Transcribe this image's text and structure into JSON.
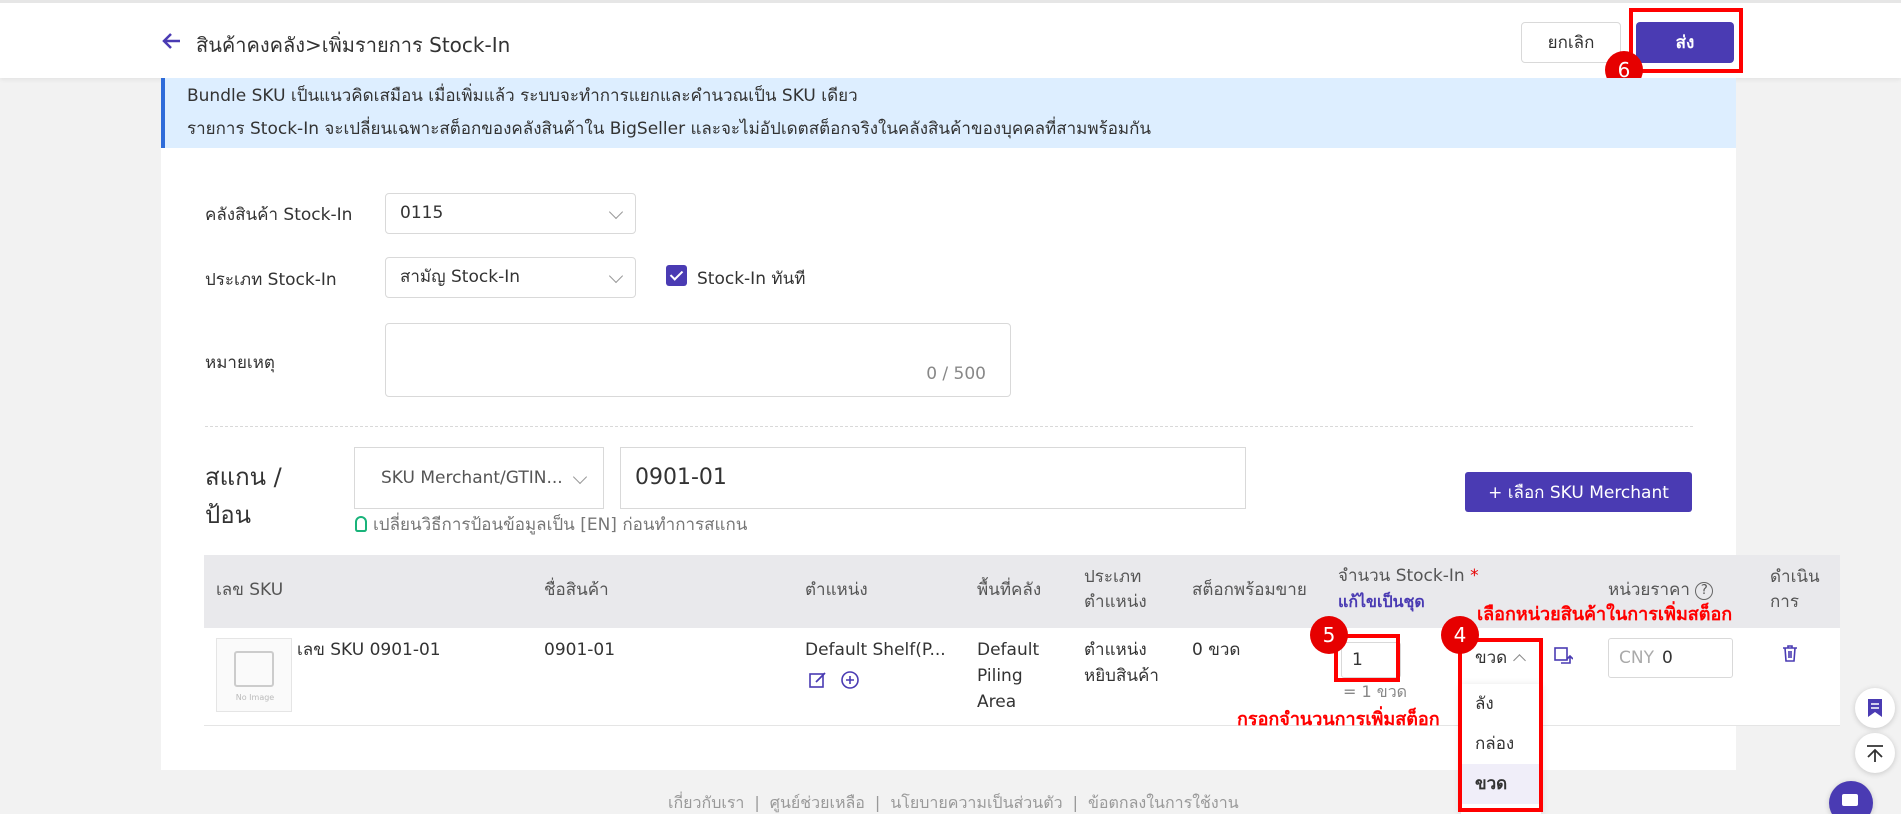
{
  "header": {
    "breadcrumb": "สินค้าคงคลัง>เพิ่มรายการ Stock-In",
    "cancel_label": "ยกเลิก",
    "submit_label": "ส่ง"
  },
  "notice": {
    "line1": "Bundle SKU เป็นแนวคิดเสมือน เมื่อเพิ่มแล้ว ระบบจะทำการแยกและคำนวณเป็น SKU เดียว",
    "line2": "รายการ Stock-In จะเปลี่ยนเฉพาะสต็อกของคลังสินค้าใน BigSeller และจะไม่อัปเดตสต็อกจริงในคลังสินค้าของบุคคลที่สามพร้อมกัน"
  },
  "form": {
    "warehouse_label": "คลังสินค้า Stock-In",
    "warehouse_value": "0115",
    "type_label": "ประเภท Stock-In",
    "type_value": "สามัญ Stock-In",
    "instant_label": "Stock-In ทันที",
    "instant_checked": true,
    "note_label": "หมายเหตุ",
    "note_counter": "0 / 500"
  },
  "scan": {
    "label_line1": "สแกน /",
    "label_line2": "ป้อน",
    "mode_value": "SKU Merchant/GTIN...",
    "input_value": "0901-01",
    "tip": "เปลี่ยนวิธีการป้อนข้อมูลเป็น [EN] ก่อนทำการสแกน",
    "add_button": "+ เลือก SKU Merchant"
  },
  "table": {
    "headers": {
      "sku": "เลข SKU",
      "name": "ชื่อสินค้า",
      "location": "ตำแหน่ง",
      "area": "พื้นที่คลัง",
      "loc_type_1": "ประเภท",
      "loc_type_2": "ตำแหน่ง",
      "available": "สต็อกพร้อมขาย",
      "qty": "จำนวน Stock-In",
      "qty_required": "*",
      "qty_link": "แก้ไขเป็นชุด",
      "price": "หน่วยราคา",
      "price_help": "?",
      "action_1": "ดำเนิน",
      "action_2": "การ"
    },
    "rows": [
      {
        "no_image": "No Image",
        "sku": "เลข SKU 0901-01",
        "name": "0901-01",
        "location": "Default Shelf(P...",
        "area_1": "Default",
        "area_2": "Piling",
        "area_3": "Area",
        "loc_type_1": "ตำแหน่ง",
        "loc_type_2": "หยิบสินค้า",
        "available": "0 ขวด",
        "qty": "1",
        "qty_sub": "= 1 ขวด",
        "unit": "ขวด",
        "currency": "CNY",
        "price": "0"
      }
    ]
  },
  "unit_dropdown": {
    "options": [
      "ลัง",
      "กล่อง",
      "ขวด"
    ],
    "selected": "ขวด"
  },
  "annotations": {
    "step4": "4",
    "step5": "5",
    "step6": "6",
    "note_unit": "เลือกหน่วยสินค้าในการเพิ่มสต็อก",
    "note_qty": "กรอกจำนวนการเพิ่มสต็อก",
    "highlight_color": "#ff0000"
  },
  "footer": {
    "about": "เกี่ยวกับเรา",
    "help": "ศูนย์ช่วยเหลือ",
    "privacy": "นโยบายความเป็นส่วนตัว",
    "terms": "ข้อตกลงในการใช้งาน",
    "sep": "|"
  },
  "colors": {
    "primary": "#4a3bb3",
    "notice_bg": "#ddeeff",
    "notice_border": "#2e6bd9"
  }
}
